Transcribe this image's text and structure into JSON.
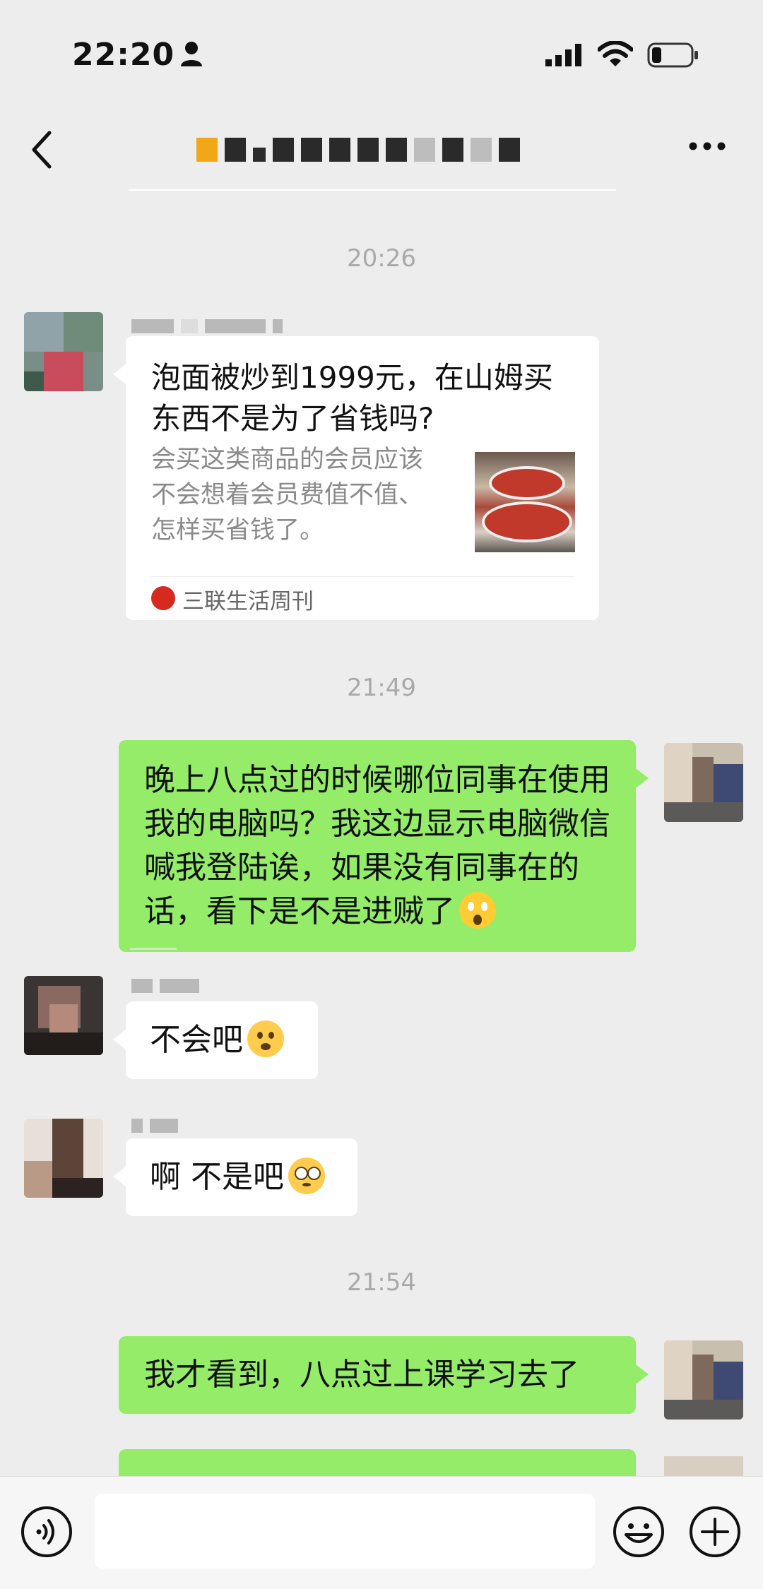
{
  "status_bar": {
    "time": "22:20",
    "battery_level": 0.25
  },
  "nav": {
    "back_icon": "chevron-left-icon",
    "more_icon": "ellipsis-icon"
  },
  "messages": [
    {
      "type": "timestamp",
      "text": "20:26"
    },
    {
      "type": "link_card",
      "side": "left",
      "title": "泡面被炒到1999元，在山姆买东西不是为了省钱吗?",
      "description": "会买这类商品的会员应该不会想着会员费值不值、怎样买省钱了。",
      "source": "三联生活周刊"
    },
    {
      "type": "timestamp",
      "text": "21:49"
    },
    {
      "type": "text",
      "side": "right",
      "text": "晚上八点过的时候哪位同事在使用我的电脑吗？我这边显示电脑微信喊我登陆诶，如果没有同事在的话，看下是不是进贼了",
      "emoji": "face-screaming-in-fear"
    },
    {
      "type": "text",
      "side": "left",
      "text": "不会吧",
      "emoji": "frowning-face-with-open-mouth"
    },
    {
      "type": "text",
      "side": "left",
      "text": "啊 不是吧",
      "emoji": "flushed-face"
    },
    {
      "type": "timestamp",
      "text": "21:54"
    },
    {
      "type": "text",
      "side": "right",
      "text": "我才看到，八点过上课学习去了"
    }
  ],
  "input_bar": {
    "voice_icon": "voice-icon",
    "emoji_icon": "smiley-icon",
    "plus_icon": "plus-icon"
  },
  "colors": {
    "background": "#ededed",
    "self_bubble": "#95ec69",
    "other_bubble": "#ffffff",
    "timestamp": "#a9a9a9"
  }
}
